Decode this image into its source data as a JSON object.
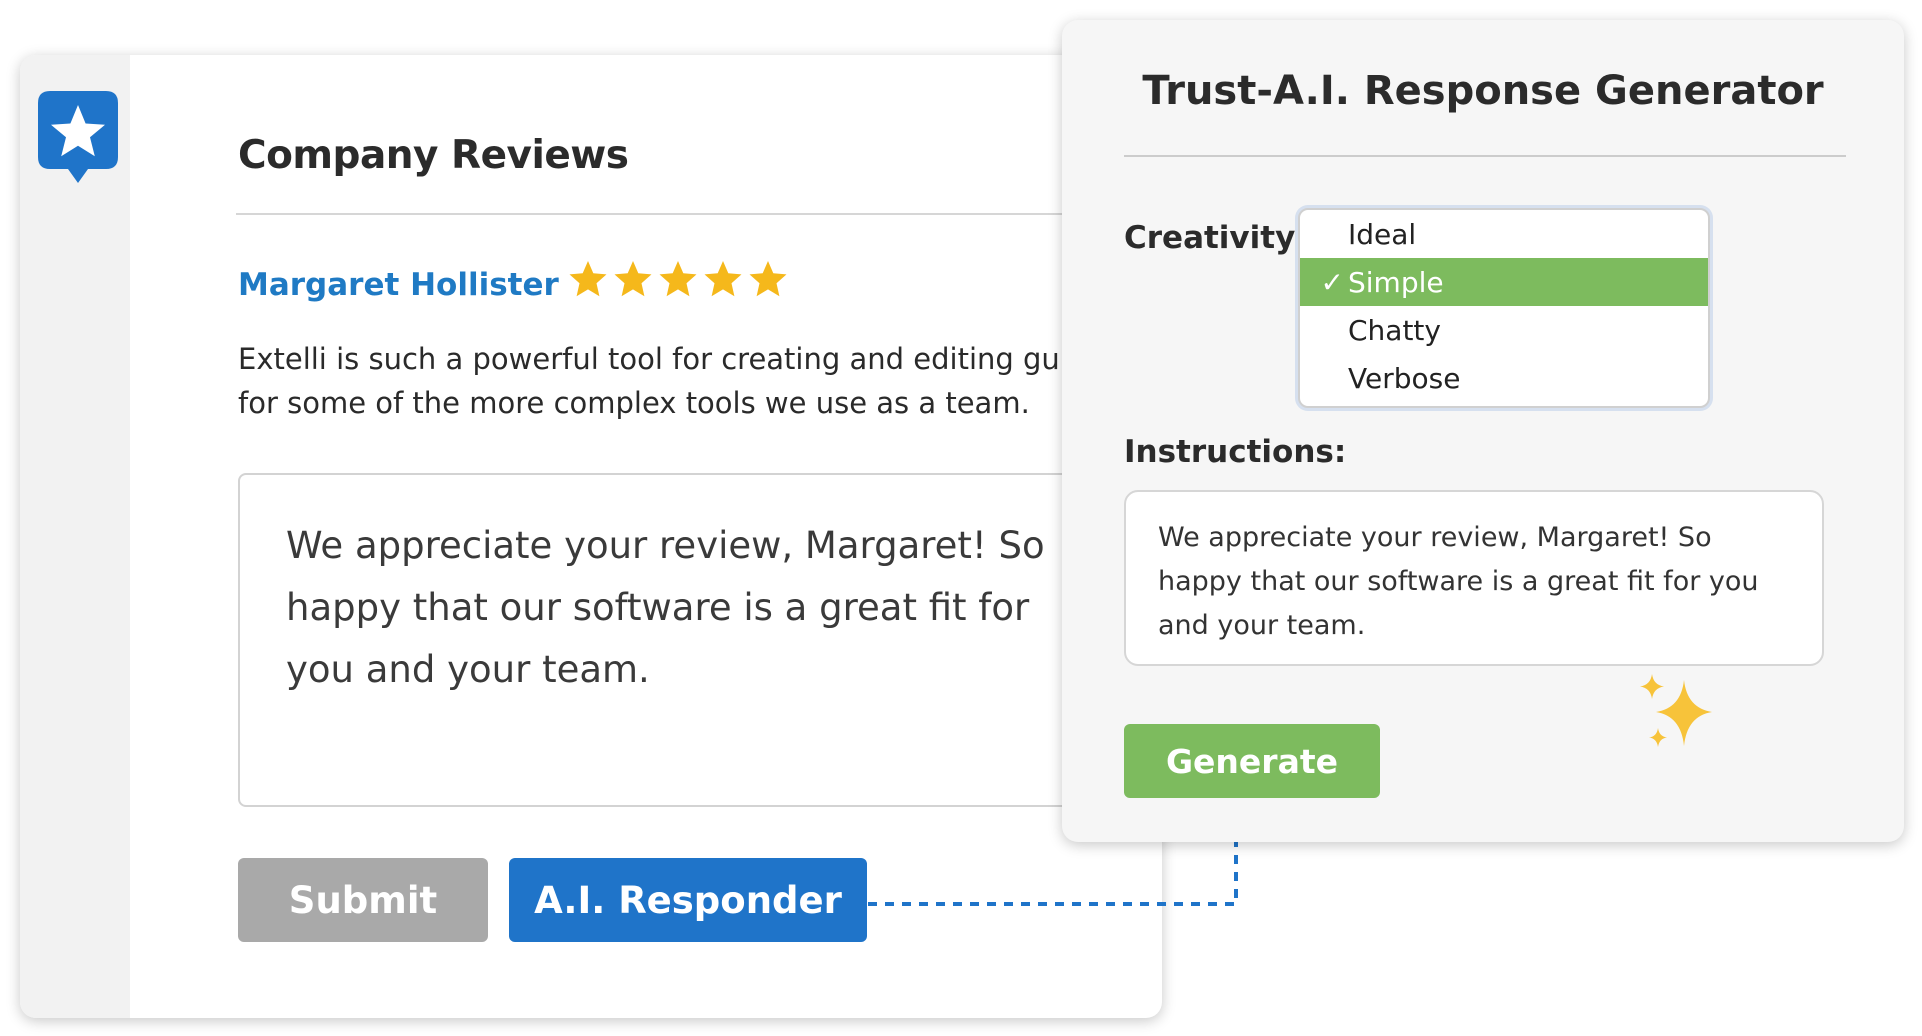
{
  "review_panel": {
    "logo_icon": "star-badge-icon",
    "title": "Company Reviews",
    "reviewer_name": "Margaret Hollister",
    "rating": 5,
    "rating_max": 5,
    "review_line_1": "Extelli is such a powerful tool for creating and editing guides",
    "review_line_2": "for some of the more complex tools we use as a team.",
    "response_text": "We appreciate your review, Margaret! So happy that our software is a great fit for you and your team.",
    "submit_label": "Submit",
    "ai_responder_label": "A.I. Responder"
  },
  "generator_panel": {
    "title": "Trust-A.I. Response Generator",
    "creativity_label": "Creativity:",
    "creativity_options": [
      {
        "label": "Ideal",
        "selected": false
      },
      {
        "label": "Simple",
        "selected": true
      },
      {
        "label": "Chatty",
        "selected": false
      },
      {
        "label": "Verbose",
        "selected": false
      }
    ],
    "check_mark": "✓",
    "instructions_label": "Instructions:",
    "instructions_text": "We appreciate your review, Margaret! So happy that our software is a great fit for you and your team.",
    "generate_label": "Generate",
    "sparkle_icon": "sparkles-icon"
  },
  "colors": {
    "brand_blue": "#1f74c9",
    "link_blue": "#1f7ac4",
    "star_gold": "#f5b81b",
    "accent_green": "#7dbb5e",
    "disabled_gray": "#a9a9a9"
  }
}
